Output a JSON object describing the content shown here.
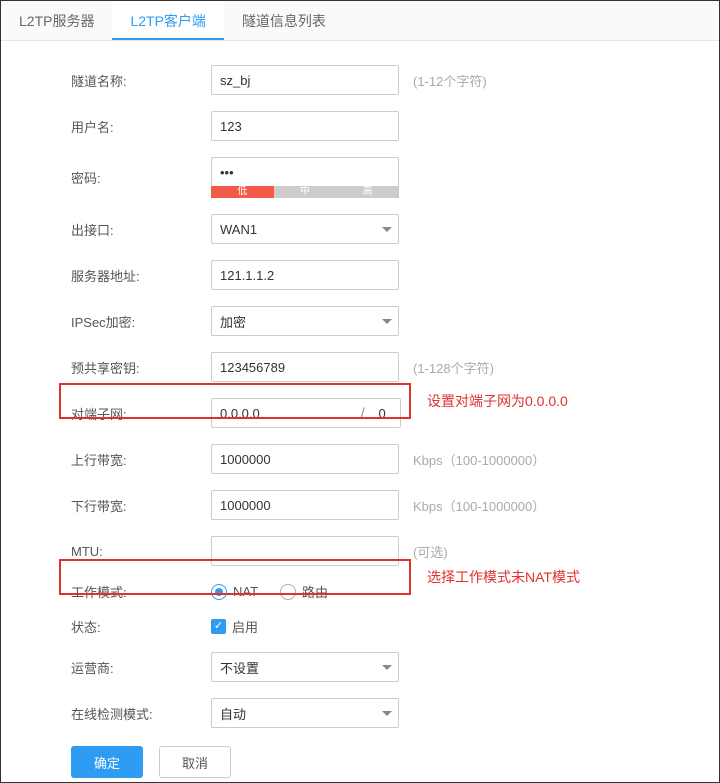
{
  "tabs": {
    "server": "L2TP服务器",
    "client": "L2TP客户端",
    "info": "隧道信息列表"
  },
  "fields": {
    "tunnel_name": {
      "label": "隧道名称:",
      "value": "sz_bj",
      "hint": "(1-12个字符)"
    },
    "username": {
      "label": "用户名:",
      "value": "123"
    },
    "password": {
      "label": "密码:",
      "value": "•••"
    },
    "strength": {
      "low": "低",
      "mid": "中",
      "high": "高"
    },
    "out_interface": {
      "label": "出接口:",
      "value": "WAN1"
    },
    "server_addr": {
      "label": "服务器地址:",
      "value": "121.1.1.2"
    },
    "ipsec": {
      "label": "IPSec加密:",
      "value": "加密"
    },
    "psk": {
      "label": "预共享密钥:",
      "value": "123456789",
      "hint": "(1-128个字符)"
    },
    "peer_subnet": {
      "label": "对端子网:",
      "ip": "0.0.0.0",
      "slash": "/",
      "mask": "0"
    },
    "upstream": {
      "label": "上行带宽:",
      "value": "1000000",
      "hint": "Kbps（100-1000000）"
    },
    "downstream": {
      "label": "下行带宽:",
      "value": "1000000",
      "hint": "Kbps（100-1000000）"
    },
    "mtu": {
      "label": "MTU:",
      "value": "",
      "hint": "(可选)"
    },
    "mode": {
      "label": "工作模式:",
      "nat": "NAT",
      "route": "路由"
    },
    "status": {
      "label": "状态:",
      "enable": "启用"
    },
    "operator": {
      "label": "运营商:",
      "value": "不设置"
    },
    "detection": {
      "label": "在线检测模式:",
      "value": "自动"
    }
  },
  "annotations": {
    "subnet": "设置对端子网为0.0.0.0",
    "mode": "选择工作模式未NAT模式"
  },
  "buttons": {
    "ok": "确定",
    "cancel": "取消"
  }
}
